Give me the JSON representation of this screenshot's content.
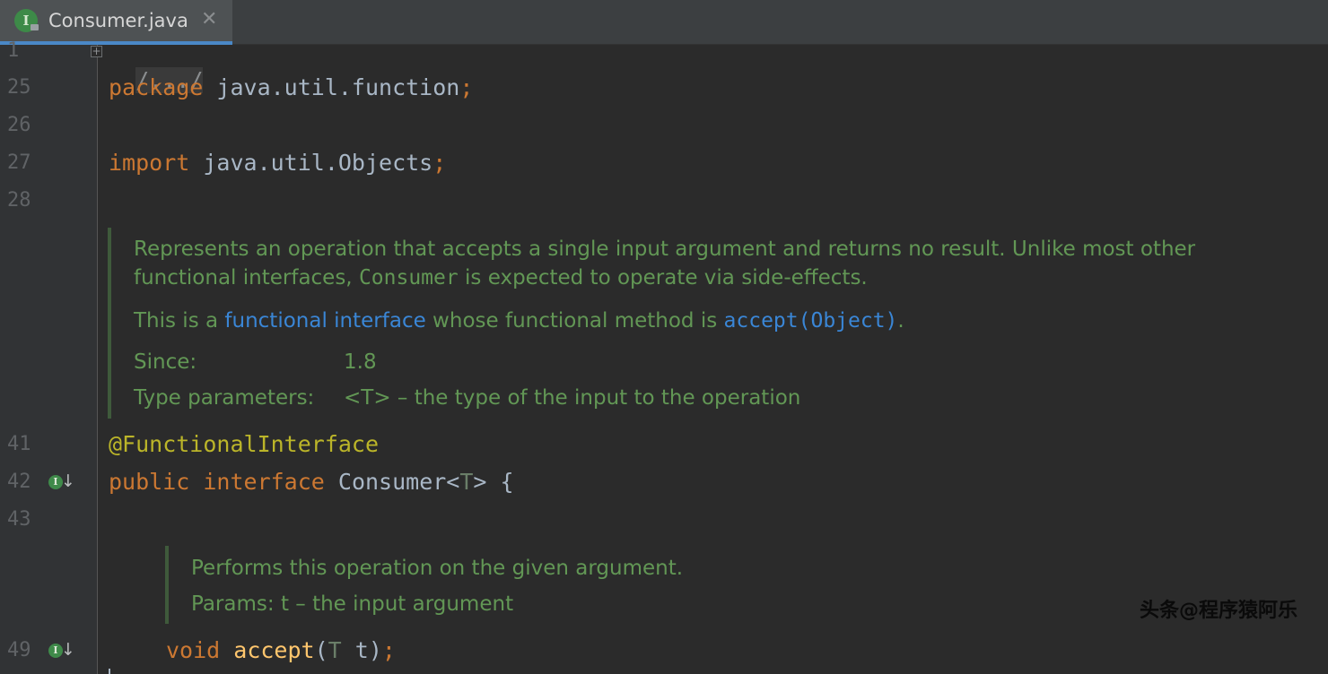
{
  "tab": {
    "title": "Consumer.java",
    "icon_letter": "I",
    "close_glyph": "✕"
  },
  "lines": {
    "l1": "1",
    "l25": "25",
    "l26": "26",
    "l27": "27",
    "l28": "28",
    "l41": "41",
    "l42": "42",
    "l43": "43",
    "l49": "49"
  },
  "code": {
    "folded_header": "/.../",
    "package_kw": "package",
    "package_name": " java.util.function",
    "semi": ";",
    "import_kw": "import",
    "import_name": " java.util.Objects",
    "annotation": "@FunctionalInterface",
    "public_kw": "public",
    "interface_kw": "interface",
    "class_name": " Consumer<",
    "type_param": "T",
    "class_rest": "> {",
    "void_kw": "void",
    "method_name": "accept",
    "paren_open": "(",
    "param_type": "T",
    "param_rest": " t)"
  },
  "doc1": {
    "line1": "Represents an operation that accepts a single input argument and returns no result. Unlike most other",
    "line2_a": "functional interfaces, ",
    "line2_code": "Consumer",
    "line2_b": " is expected to operate via side-effects.",
    "line3_a": "This is a ",
    "line3_link": "functional interface",
    "line3_b": " whose functional method is ",
    "line3_method": "accept(Object)",
    "line3_end": ".",
    "since_label": "Since:",
    "since_value": "1.8",
    "type_params_label": "Type parameters:",
    "type_params_value": "<T> – the type of the input to the operation"
  },
  "doc2": {
    "line1": "Performs this operation on the given argument.",
    "params_label": "Params:",
    "params_value": "t – the input argument"
  },
  "watermark": "头条@程序猿阿乐",
  "colors": {
    "background": "#2b2b2b",
    "keyword": "#cc7832",
    "annotation": "#bbb529",
    "doc_text": "#629755",
    "doc_link": "#3a86d6",
    "method": "#ffc66d"
  }
}
